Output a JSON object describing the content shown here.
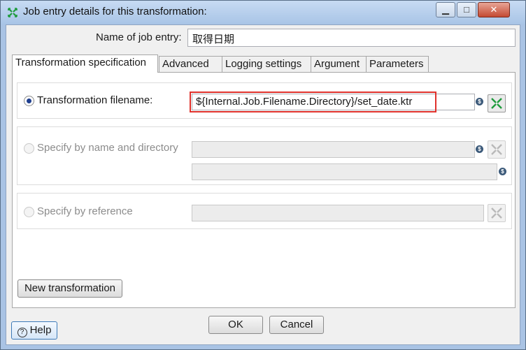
{
  "window": {
    "title": "Job entry details for this transformation:",
    "icon": "spoon-transformation-icon",
    "controls": {
      "minimize": "▁",
      "maximize": "□",
      "close": "✕"
    }
  },
  "name_row": {
    "label": "Name of job entry:",
    "value": "取得日期"
  },
  "tabs": [
    {
      "label": "Transformation specification",
      "active": true
    },
    {
      "label": "Advanced",
      "active": false
    },
    {
      "label": "Logging settings",
      "active": false
    },
    {
      "label": "Argument",
      "active": false
    },
    {
      "label": "Parameters",
      "active": false
    }
  ],
  "spec": {
    "filename": {
      "label": "Transformation filename:",
      "selected": true,
      "value": "${Internal.Job.Filename.Directory}/set_date.ktr"
    },
    "by_name": {
      "label": "Specify by name and directory",
      "selected": false,
      "name_value": "",
      "dir_value": ""
    },
    "by_ref": {
      "label": "Specify by reference",
      "selected": false,
      "value": ""
    },
    "variable_symbol": "$",
    "new_transformation_label": "New transformation"
  },
  "footer": {
    "help_label": "Help",
    "help_icon": "?",
    "ok_label": "OK",
    "cancel_label": "Cancel"
  },
  "colors": {
    "highlight": "#e0322c",
    "radio_selected": "#1f3f8f",
    "browse_icon": "#1e9b3c"
  }
}
